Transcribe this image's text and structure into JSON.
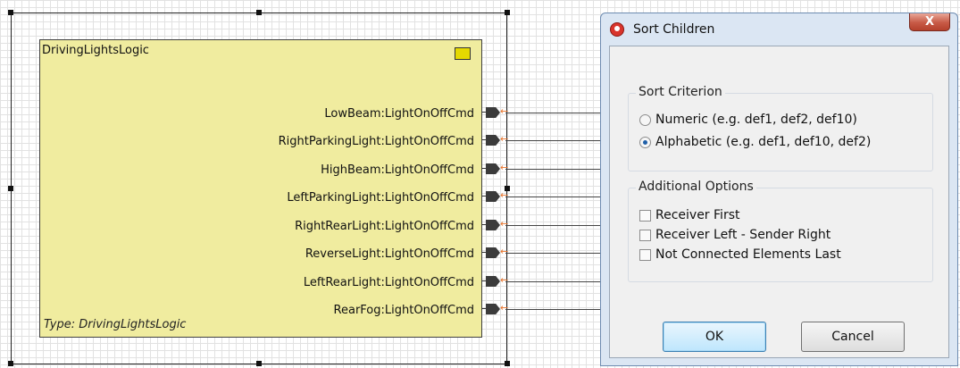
{
  "component": {
    "name": "DrivingLightsLogic",
    "type_label": "Type: DrivingLightsLogic",
    "ports": [
      "LowBeam:LightOnOffCmd",
      "RightParkingLight:LightOnOffCmd",
      "HighBeam:LightOnOffCmd",
      "LeftParkingLight:LightOnOffCmd",
      "RightRearLight:LightOnOffCmd",
      "ReverseLight:LightOnOffCmd",
      "LeftRearLight:LightOnOffCmd",
      "RearFog:LightOnOffCmd"
    ]
  },
  "dialog": {
    "title": "Sort Children",
    "close_glyph": "X",
    "sort_criterion": {
      "legend": "Sort Criterion",
      "options": [
        {
          "label": "Numeric (e.g. def1, def2, def10)",
          "selected": false
        },
        {
          "label": "Alphabetic (e.g. def1, def10, def2)",
          "selected": true
        }
      ]
    },
    "additional_options": {
      "legend": "Additional Options",
      "options": [
        {
          "label": "Receiver First",
          "checked": false
        },
        {
          "label": "Receiver Left - Sender Right",
          "checked": false
        },
        {
          "label": "Not Connected Elements Last",
          "checked": false
        }
      ]
    },
    "ok_label": "OK",
    "cancel_label": "Cancel"
  },
  "colors": {
    "component_fill": "#f0ec9f",
    "dialog_frame": "#dbe6f3",
    "close_button": "#c75a46",
    "port_arrow": "#e8742c"
  },
  "icons": {
    "app": "red-swirl-icon",
    "component": "component-type-icon",
    "port": "port-connector-icon",
    "close": "close-icon"
  }
}
